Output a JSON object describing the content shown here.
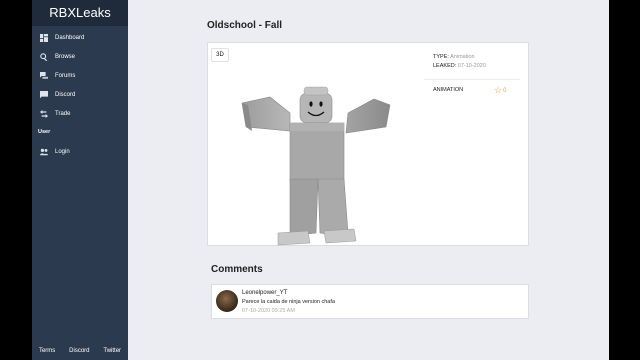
{
  "brand": "RBXLeaks",
  "nav": [
    {
      "label": "Dashboard",
      "icon": "dashboard-icon"
    },
    {
      "label": "Browse",
      "icon": "search-icon"
    },
    {
      "label": "Forums",
      "icon": "forum-icon"
    },
    {
      "label": "Discord",
      "icon": "chat-icon"
    },
    {
      "label": "Trade",
      "icon": "swap-icon"
    }
  ],
  "user_section": {
    "heading": "User",
    "login_label": "Login",
    "login_icon": "people-icon"
  },
  "footer": [
    "Terms",
    "Discord",
    "Twitter"
  ],
  "item": {
    "title": "Oldschool - Fall",
    "view_badge": "3D",
    "type_label": "TYPE:",
    "type_value": "Animation",
    "leaked_label": "LEAKED:",
    "leaked_value": "07-10-2020",
    "category_tag": "ANIMATION",
    "favorites": "0"
  },
  "comments": {
    "heading": "Comments",
    "items": [
      {
        "user": "Leonelpower_YT",
        "text": "Parece la caida de ninja version chafa",
        "time": "07-10-2020 09:25 AM"
      }
    ]
  },
  "colors": {
    "sidebar": "#2b3a4e",
    "brand_bar": "#1f2b3b",
    "page_bg": "#ececf3",
    "star": "#e8a33d"
  }
}
